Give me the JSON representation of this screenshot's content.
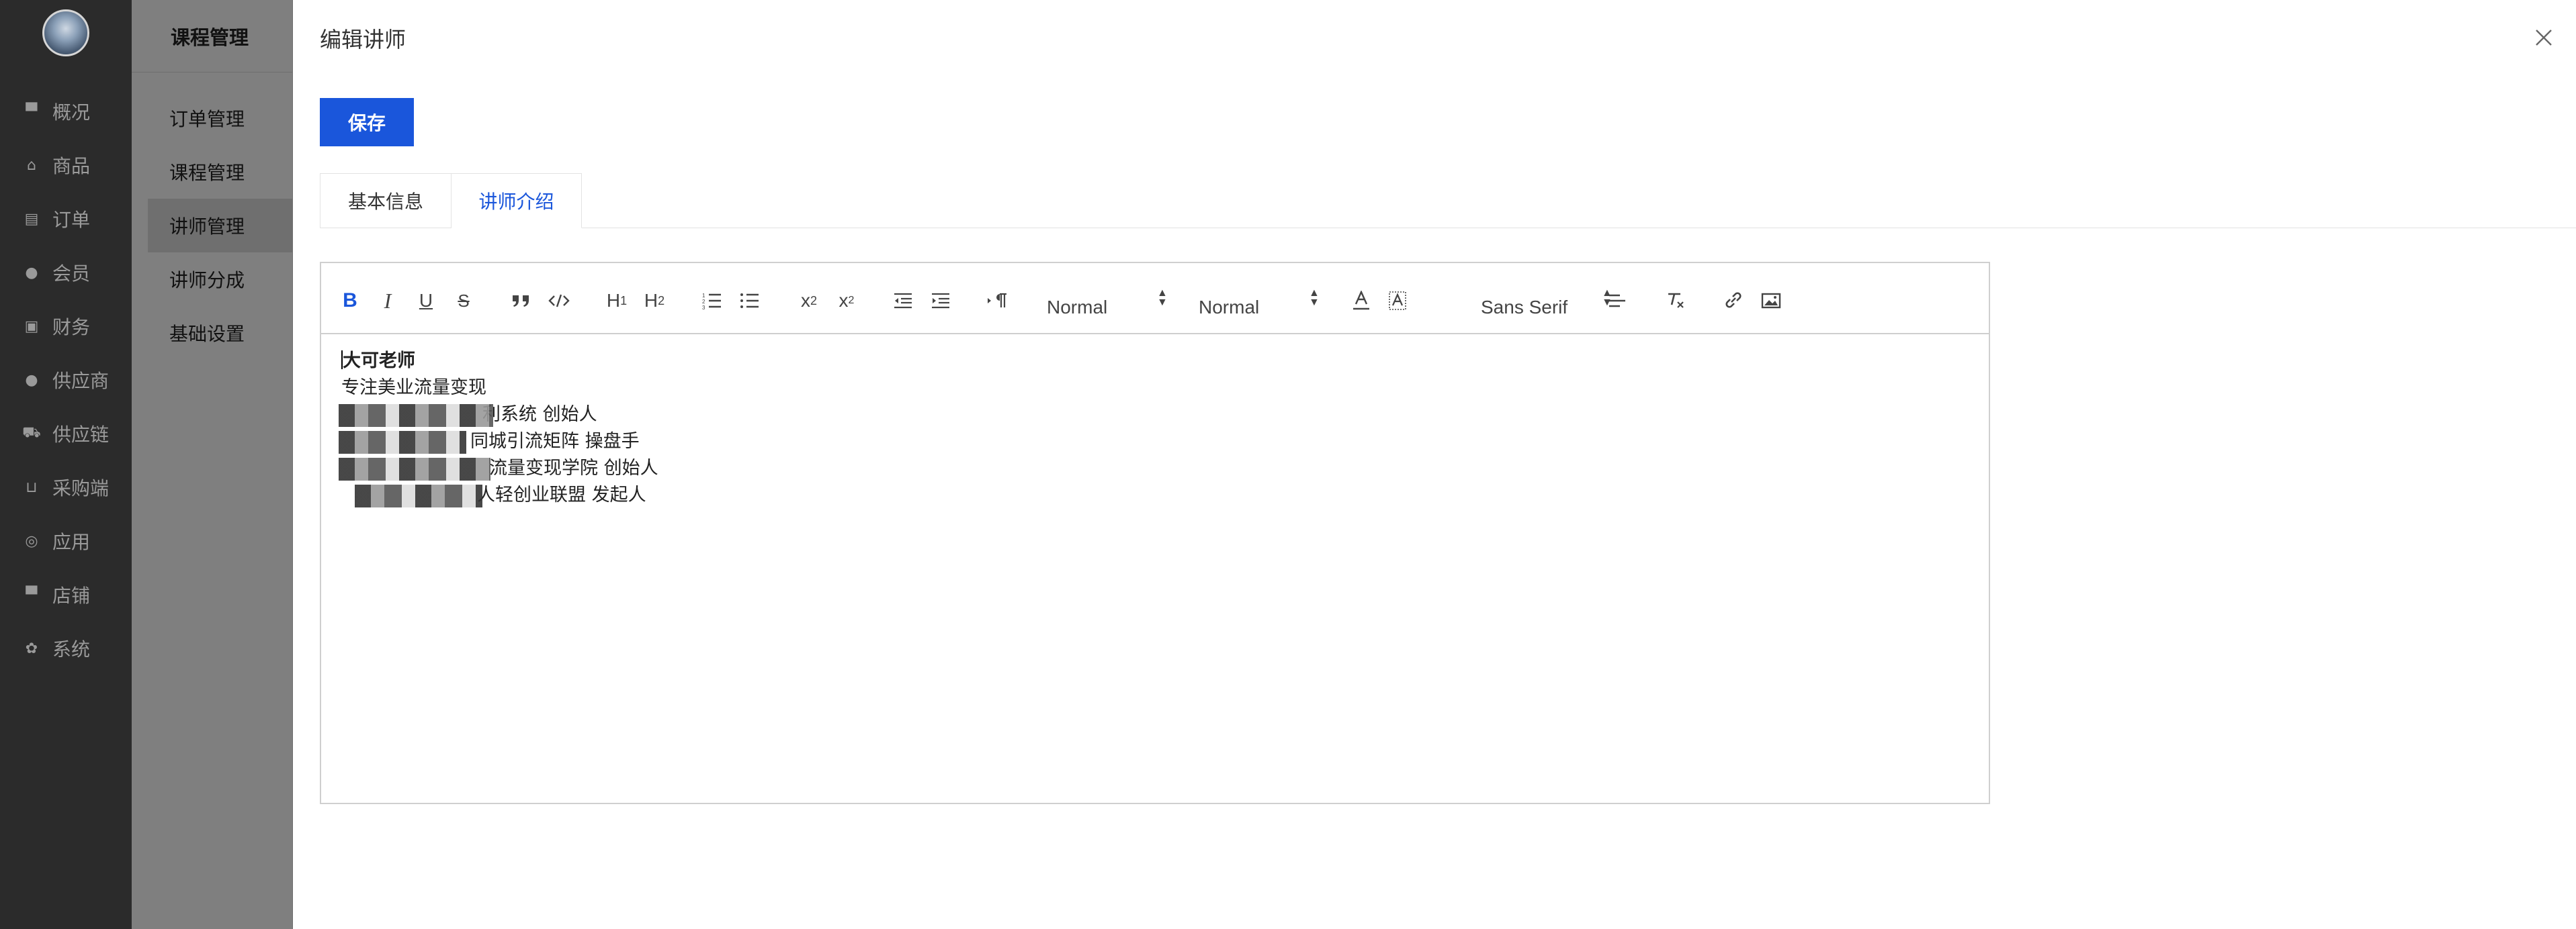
{
  "nav": {
    "items": [
      {
        "label": "概况",
        "icon": "monitor-icon"
      },
      {
        "label": "商品",
        "icon": "bag-icon"
      },
      {
        "label": "订单",
        "icon": "clipboard-icon"
      },
      {
        "label": "会员",
        "icon": "user-icon"
      },
      {
        "label": "财务",
        "icon": "money-icon"
      },
      {
        "label": "供应商",
        "icon": "user-icon"
      },
      {
        "label": "供应链",
        "icon": "truck-icon"
      },
      {
        "label": "采购端",
        "icon": "cart-icon"
      },
      {
        "label": "应用",
        "icon": "app-icon"
      },
      {
        "label": "店铺",
        "icon": "store-icon"
      },
      {
        "label": "系统",
        "icon": "gear-icon"
      }
    ]
  },
  "subnav": {
    "title": "课程管理",
    "items": [
      "订单管理",
      "课程管理",
      "讲师管理",
      "讲师分成",
      "基础设置"
    ],
    "active_index": 2
  },
  "drawer": {
    "title": "编辑讲师",
    "save_label": "保存",
    "tabs": [
      "基本信息",
      "讲师介绍"
    ],
    "active_tab": 1
  },
  "editor": {
    "toolbar": {
      "header_picker": "Normal",
      "size_picker": "Normal",
      "font_picker": "Sans Serif"
    },
    "lines": [
      "大可老师",
      "专注美业流量变现",
      "利系统 创始人",
      "同城引流矩阵 操盘手",
      "流量变现学院 创始人",
      "人轻创业联盟 发起人"
    ]
  }
}
